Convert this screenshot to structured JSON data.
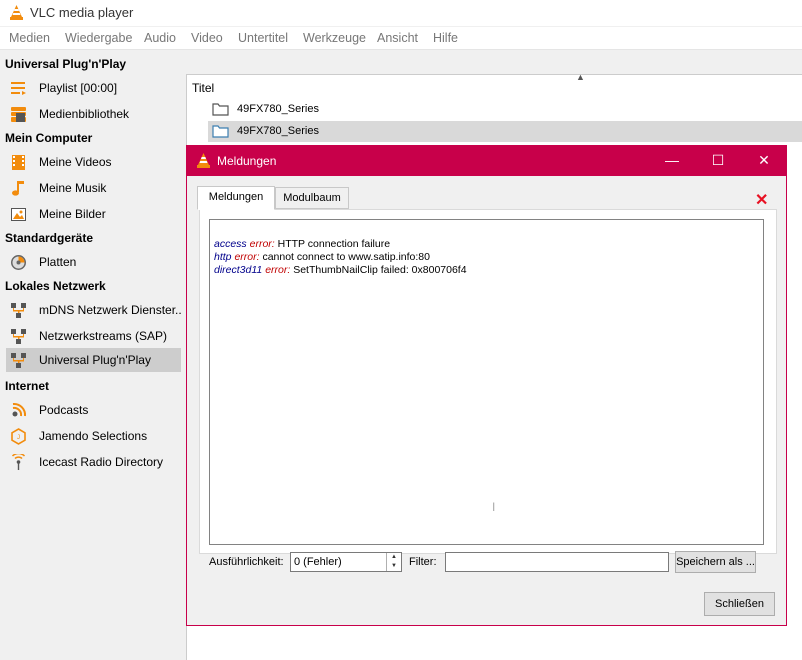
{
  "app": {
    "title": "VLC media player"
  },
  "menu": [
    "Medien",
    "Wiedergabe",
    "Audio",
    "Video",
    "Untertitel",
    "Werkzeuge",
    "Ansicht",
    "Hilfe"
  ],
  "sidebar": {
    "sections": [
      {
        "label": "Universal Plug'n'Play"
      },
      {
        "label": "Mein Computer"
      },
      {
        "label": "Standardgeräte"
      },
      {
        "label": "Lokales Netzwerk"
      },
      {
        "label": "Internet"
      }
    ],
    "items": [
      {
        "label": "Playlist [00:00]",
        "icon": "playlist-icon"
      },
      {
        "label": "Medienbibliothek",
        "icon": "media-library-icon"
      },
      {
        "label": "Meine Videos",
        "icon": "film-icon"
      },
      {
        "label": "Meine Musik",
        "icon": "music-note-icon"
      },
      {
        "label": "Meine Bilder",
        "icon": "picture-icon"
      },
      {
        "label": "Platten",
        "icon": "disc-icon"
      },
      {
        "label": "mDNS Netzwerk Dienster...",
        "icon": "network-icon"
      },
      {
        "label": "Netzwerkstreams (SAP)",
        "icon": "network-icon"
      },
      {
        "label": "Universal Plug'n'Play",
        "icon": "network-icon",
        "selected": true
      },
      {
        "label": "Podcasts",
        "icon": "podcast-icon"
      },
      {
        "label": "Jamendo Selections",
        "icon": "jamendo-icon"
      },
      {
        "label": "Icecast Radio Directory",
        "icon": "radio-icon"
      }
    ]
  },
  "playlist": {
    "column_header": "Titel",
    "rows": [
      {
        "label": "49FX780_Series",
        "selected": false
      },
      {
        "label": "49FX780_Series",
        "selected": true
      }
    ]
  },
  "dialog": {
    "title": "Meldungen",
    "tabs": [
      "Meldungen",
      "Modulbaum"
    ],
    "active_tab": "Meldungen",
    "log": [
      {
        "module": "access",
        "level": "error:",
        "text": "HTTP connection failure"
      },
      {
        "module": "http",
        "level": "error:",
        "text": "cannot connect to www.satip.info:80"
      },
      {
        "module": "direct3d11",
        "level": "error:",
        "text": "SetThumbNailClip failed: 0x800706f4"
      }
    ],
    "verbosity_label": "Ausführlichkeit:",
    "verbosity_value": "0 (Fehler)",
    "filter_label": "Filter:",
    "filter_value": "",
    "save_label": "Speichern als ...",
    "close_label": "Schließen"
  },
  "colors": {
    "accent": "#c8004a",
    "error": "#c00000",
    "module": "#00008b",
    "close_x": "#e81123"
  }
}
